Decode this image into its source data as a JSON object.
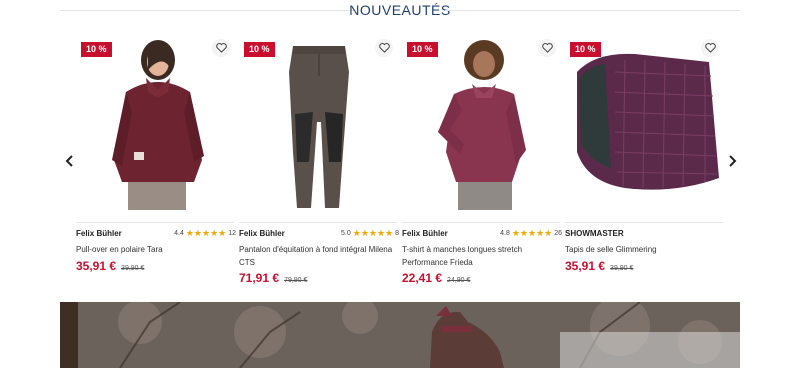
{
  "section": {
    "title": "NOUVEAUTÉS"
  },
  "carousel": {
    "products": [
      {
        "badge": "10 %",
        "brand": "Felix Bühler",
        "rating": "4.4",
        "stars": "★★★★★",
        "reviews": "12",
        "name": "Pull-over en polaire Tara",
        "price": "35,91 €",
        "old_price": "39,90 €",
        "image": "burgundy-fleece-pullover"
      },
      {
        "badge": "10 %",
        "brand": "Felix Bühler",
        "rating": "5.0",
        "stars": "★★★★★",
        "reviews": "8",
        "name": "Pantalon d'équitation à fond intégral Milena CTS",
        "price": "71,91 €",
        "old_price": "79,90 €",
        "image": "brown-riding-breeches"
      },
      {
        "badge": "10 %",
        "brand": "Felix Bühler",
        "rating": "4.8",
        "stars": "★★★★★",
        "reviews": "26",
        "name": "T-shirt à manches longues stretch Performance Frieda",
        "price": "22,41 €",
        "old_price": "24,90 €",
        "image": "long-sleeve-shirt"
      },
      {
        "badge": "10 %",
        "brand": "SHOWMASTER",
        "rating": "",
        "stars": "",
        "reviews": "",
        "name": "Tapis de selle Glimmering",
        "price": "35,91 €",
        "old_price": "39,90 €",
        "image": "purple-saddle-pad"
      }
    ]
  },
  "colors": {
    "accent": "#c8102e",
    "title": "#1f3f73",
    "star": "#f2a800"
  },
  "icons": {
    "prev": "chevron-left-icon",
    "next": "chevron-right-icon",
    "wishlist": "heart-icon"
  },
  "hero": {
    "image": "horse-banner"
  }
}
